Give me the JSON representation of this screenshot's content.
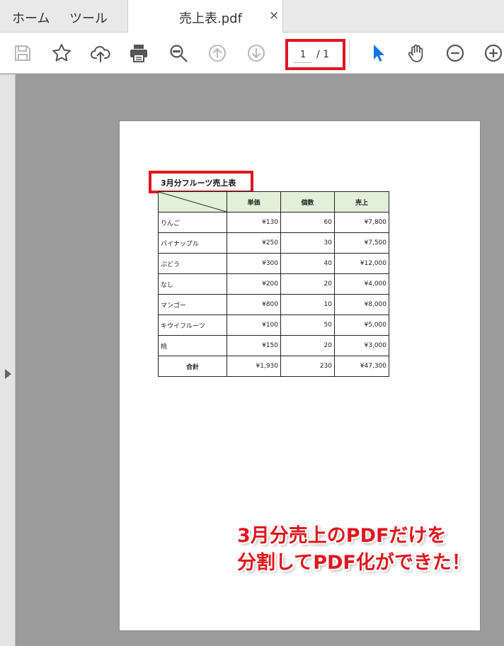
{
  "tabs": {
    "home": "ホーム",
    "tools": "ツール",
    "document": "売上表.pdf",
    "close": "×"
  },
  "toolbar": {
    "icons": [
      "save-icon",
      "star-icon",
      "cloud-upload-icon",
      "print-icon",
      "zoom-search-icon",
      "page-up-icon",
      "page-down-icon",
      "select-cursor-icon",
      "hand-icon",
      "zoom-out-icon",
      "zoom-in-icon"
    ],
    "current_page": "1",
    "total_pages": "/ 1"
  },
  "colors": {
    "accent": "#1473e6",
    "highlight": "#e0161e",
    "header_fill": "#e2efda"
  },
  "document": {
    "sheet_title": "3月分フルーツ売上表",
    "table": {
      "headers": [
        "",
        "単価",
        "個数",
        "売上"
      ],
      "rows": [
        [
          "りんご",
          "¥130",
          "60",
          "¥7,800"
        ],
        [
          "パイナップル",
          "¥250",
          "30",
          "¥7,500"
        ],
        [
          "ぶどう",
          "¥300",
          "40",
          "¥12,000"
        ],
        [
          "なし",
          "¥200",
          "20",
          "¥4,000"
        ],
        [
          "マンゴー",
          "¥800",
          "10",
          "¥8,000"
        ],
        [
          "キウイフルーツ",
          "¥100",
          "50",
          "¥5,000"
        ],
        [
          "桃",
          "¥150",
          "20",
          "¥3,000"
        ]
      ],
      "total": [
        "合計",
        "¥1,930",
        "230",
        "¥47,300"
      ]
    }
  },
  "annotation": {
    "line1": "3月分売上のPDFだけを",
    "line2": "分割してPDF化ができた！"
  }
}
